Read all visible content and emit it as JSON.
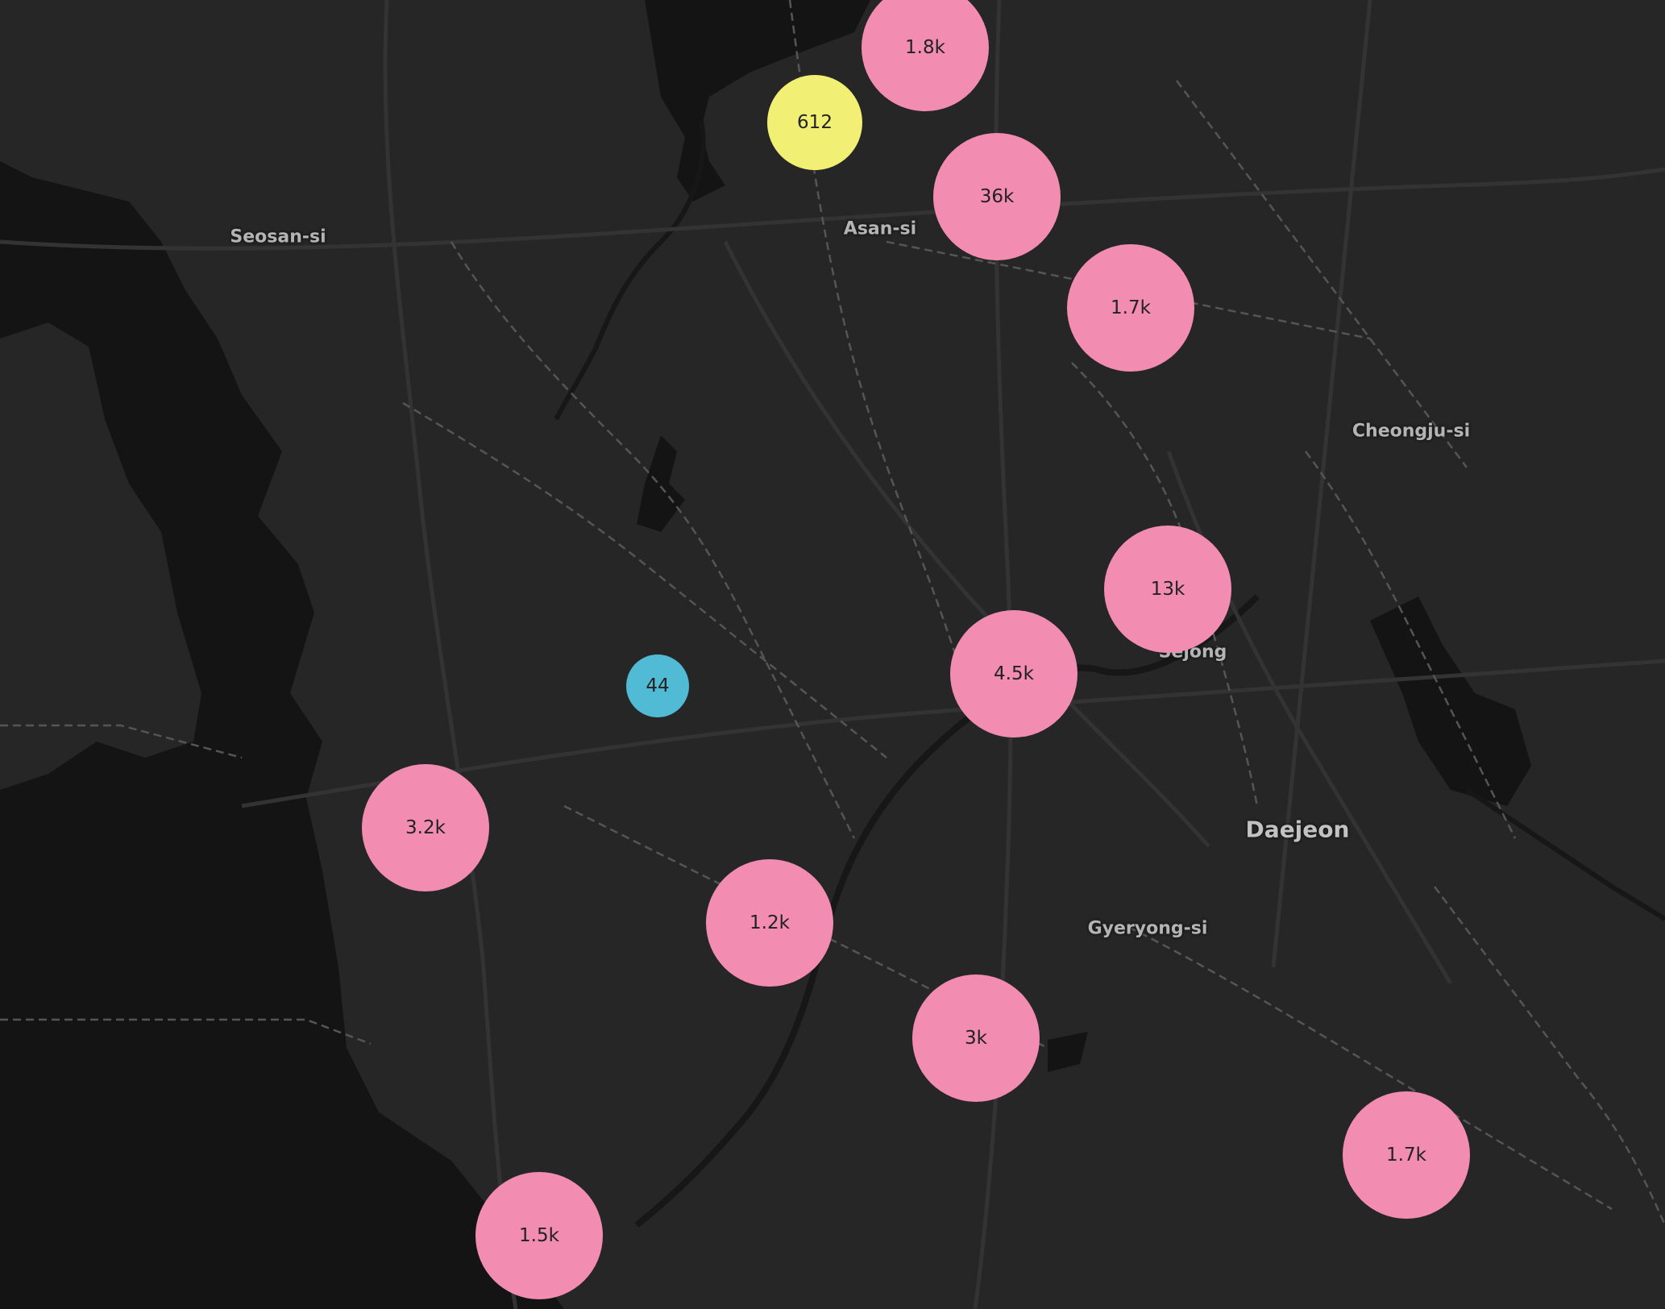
{
  "map": {
    "colors": {
      "background": "#262626",
      "water": "#141414",
      "roads": "#333333",
      "boundaries": "#555555",
      "label": "#b4b4b4",
      "cluster_large": "#f28cb1",
      "cluster_medium": "#f1f075",
      "cluster_small": "#51bbd6"
    },
    "labels": {
      "seosan": "Seosan-si",
      "asan": "Asan-si",
      "cheongju": "Cheongju-si",
      "sejong": "Sejong",
      "daejeon": "Daejeon",
      "gyeryong": "Gyeryong-si"
    },
    "clusters": [
      {
        "label": "1.8k",
        "tier": "large"
      },
      {
        "label": "612",
        "tier": "medium"
      },
      {
        "label": "36k",
        "tier": "large"
      },
      {
        "label": "1.7k",
        "tier": "large"
      },
      {
        "label": "13k",
        "tier": "large"
      },
      {
        "label": "4.5k",
        "tier": "large"
      },
      {
        "label": "44",
        "tier": "small"
      },
      {
        "label": "3.2k",
        "tier": "large"
      },
      {
        "label": "1.2k",
        "tier": "large"
      },
      {
        "label": "3k",
        "tier": "large"
      },
      {
        "label": "1.7k",
        "tier": "large"
      },
      {
        "label": "1.5k",
        "tier": "large"
      }
    ]
  }
}
